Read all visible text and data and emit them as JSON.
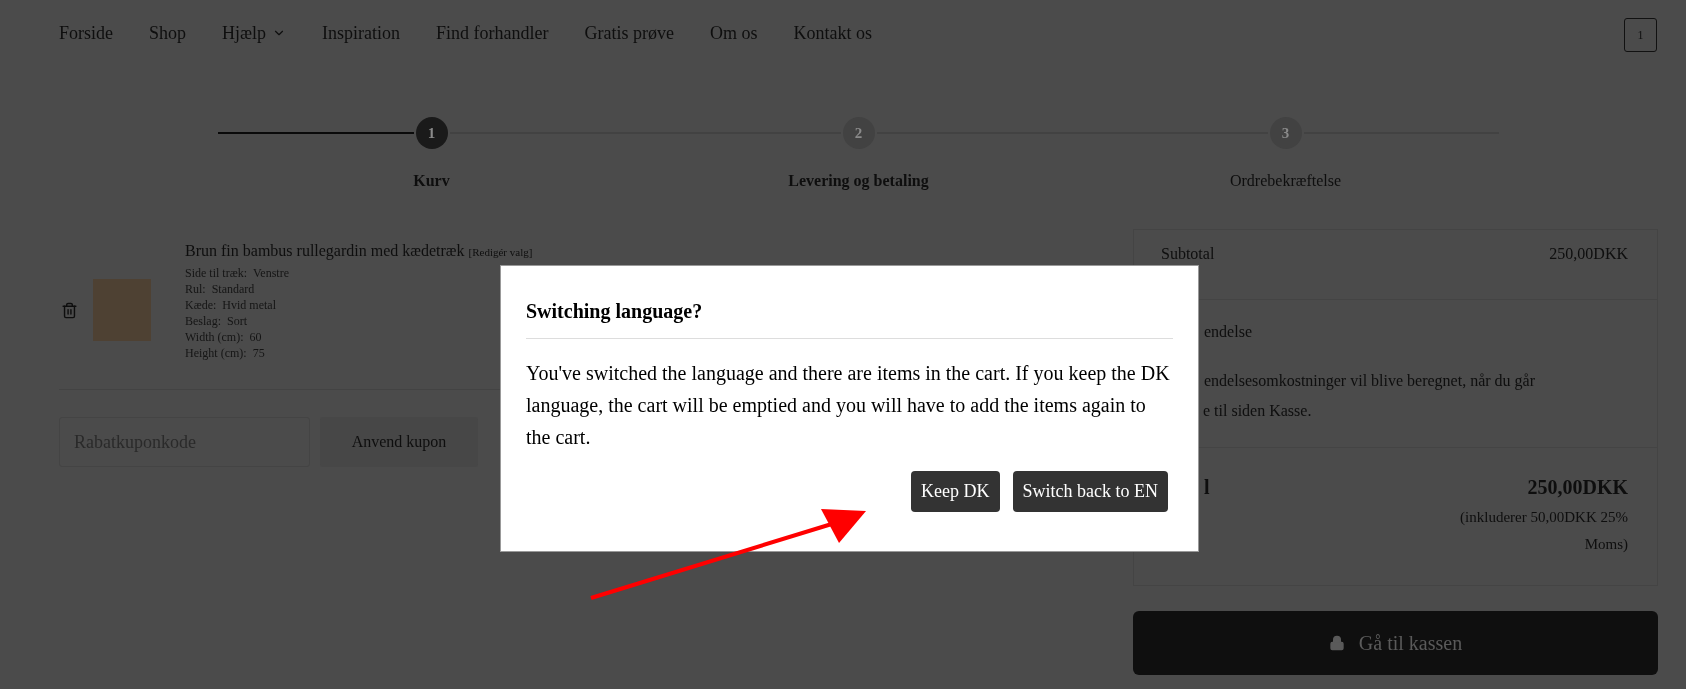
{
  "nav": {
    "items": [
      {
        "label": "Forside",
        "dropdown": false
      },
      {
        "label": "Shop",
        "dropdown": false
      },
      {
        "label": "Hjælp",
        "dropdown": true
      },
      {
        "label": "Inspiration",
        "dropdown": false
      },
      {
        "label": "Find forhandler",
        "dropdown": false
      },
      {
        "label": "Gratis prøve",
        "dropdown": false
      },
      {
        "label": "Om os",
        "dropdown": false
      },
      {
        "label": "Kontakt os",
        "dropdown": false
      }
    ],
    "cart_count": "1"
  },
  "steps": [
    {
      "number": "1",
      "label": "Kurv",
      "selected": true,
      "emphasized": true
    },
    {
      "number": "2",
      "label": "Levering og betaling",
      "selected": false,
      "emphasized": true
    },
    {
      "number": "3",
      "label": "Ordrebekræftelse",
      "selected": false,
      "emphasized": false
    }
  ],
  "cart": {
    "product": {
      "title": "Brun fin bambus rullegardin med kædetræk",
      "edit_link": "[Redigér valg]",
      "attributes": [
        {
          "name": "Side til træk:",
          "value": "Venstre"
        },
        {
          "name": "Rul:",
          "value": "Standard"
        },
        {
          "name": "Kæde:",
          "value": "Hvid metal"
        },
        {
          "name": "Beslag:",
          "value": "Sort"
        },
        {
          "name": "Width (cm):",
          "value": "60"
        },
        {
          "name": "Height (cm):",
          "value": "75"
        }
      ]
    },
    "coupon": {
      "placeholder": "Rabatkuponkode",
      "button": "Anvend kupon"
    }
  },
  "summary": {
    "subtotal_label": "Subtotal",
    "subtotal_value": "250,00DKK",
    "shipping_label": "endelse",
    "shipping_note_lines": [
      "endelsesomkostninger vil blive beregnet, når du går",
      "e til siden Kasse."
    ],
    "total_label": "l",
    "total_value": "250,00DKK",
    "tax_note": "(inkluderer 50,00DKK 25% Moms)",
    "checkout_button": "Gå til kassen"
  },
  "modal": {
    "title": "Switching language?",
    "body": "You've switched the language and there are items in the cart. If you keep the DK language, the cart will be emptied and you will have to add the items again to the cart.",
    "buttons": [
      "Keep DK",
      "Switch back to EN"
    ]
  }
}
